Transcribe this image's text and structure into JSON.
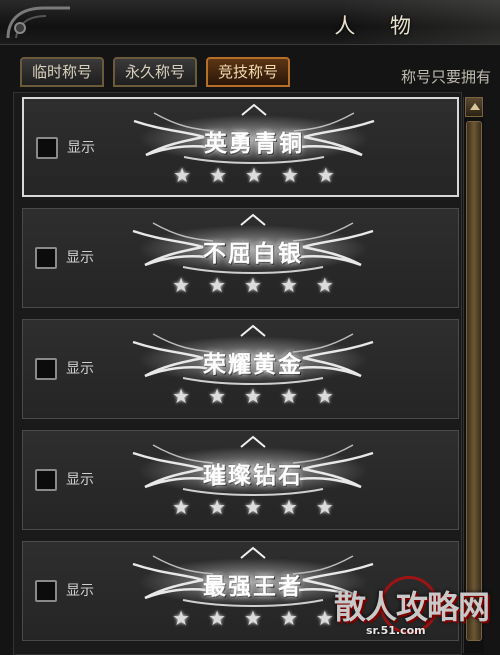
{
  "window": {
    "title": "人 物"
  },
  "tabs": [
    {
      "label": "临时称号",
      "active": false
    },
    {
      "label": "永久称号",
      "active": false
    },
    {
      "label": "竞技称号",
      "active": true
    }
  ],
  "hint_text": "称号只要拥有",
  "titles": [
    {
      "badge": "英勇青铜",
      "show_label": "显示",
      "checked": false,
      "stars": 5,
      "selected": true
    },
    {
      "badge": "不屈白银",
      "show_label": "显示",
      "checked": false,
      "stars": 5,
      "selected": false
    },
    {
      "badge": "荣耀黄金",
      "show_label": "显示",
      "checked": false,
      "stars": 5,
      "selected": false
    },
    {
      "badge": "璀璨钻石",
      "show_label": "显示",
      "checked": false,
      "stars": 5,
      "selected": false
    },
    {
      "badge": "最强王者",
      "show_label": "显示",
      "checked": false,
      "stars": 5,
      "selected": false
    }
  ],
  "watermark": {
    "logo": "散人攻略网",
    "url": "sr.51.com"
  },
  "colors": {
    "active_tab": "#b66f27",
    "background": "#141414",
    "row": "#2a2a2a"
  }
}
